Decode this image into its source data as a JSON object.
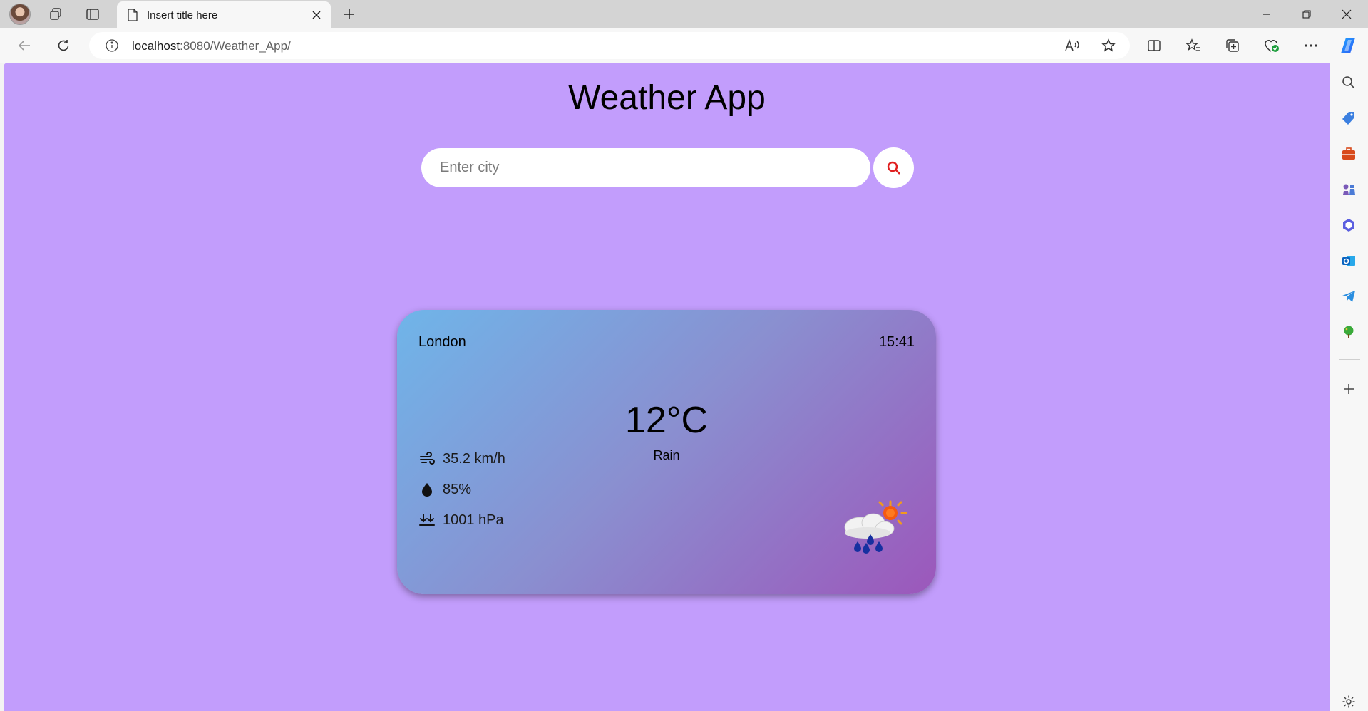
{
  "browser": {
    "tab_title": "Insert title here",
    "url_host": "localhost",
    "url_path": ":8080/Weather_App/"
  },
  "app": {
    "title": "Weather App",
    "search": {
      "placeholder": "Enter city",
      "value": ""
    }
  },
  "weather": {
    "city": "London",
    "time": "15:41",
    "temperature": "12°C",
    "condition": "Rain",
    "wind": "35.2 km/h",
    "humidity": "85%",
    "pressure": "1001 hPa",
    "icon": "rain-sun-cloud-icon"
  },
  "colors": {
    "page_background": "#c29dfc",
    "card_gradient_start": "#6fb5e9",
    "card_gradient_end": "#9c57bb",
    "search_icon": "#e02020"
  }
}
